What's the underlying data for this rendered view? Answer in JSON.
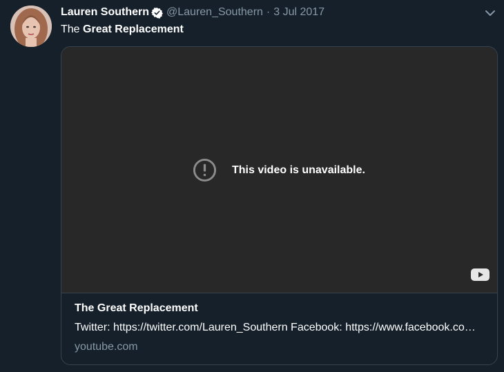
{
  "tweet": {
    "author_name": "Lauren Southern",
    "handle": "@Lauren_Southern",
    "separator": "·",
    "date": "3 Jul 2017",
    "text_prefix": "The ",
    "text_bold": "Great Replacement"
  },
  "card": {
    "video_message": "This video is unavailable.",
    "title": "The Great Replacement",
    "description": "Twitter: https://twitter.com/Lauren_Southern Facebook: https://www.facebook.com/laurensouthernofficial",
    "domain": "youtube.com"
  },
  "icons": {
    "verified": "verified-badge-icon",
    "menu": "chevron-down-icon",
    "warning": "exclamation-circle-icon",
    "platform": "youtube-icon"
  },
  "colors": {
    "background": "#15202b",
    "secondary_text": "#8899a6",
    "border": "#38444d",
    "video_background": "#282828"
  }
}
